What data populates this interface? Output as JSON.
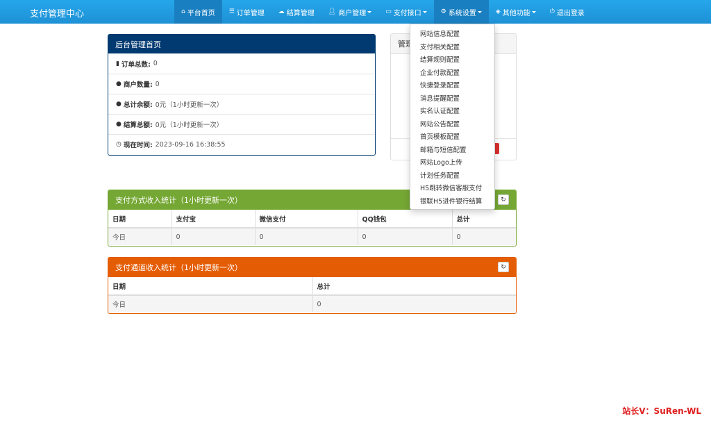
{
  "brand": "支付管理中心",
  "nav": [
    {
      "label": "平台首页",
      "icon": "home-icon"
    },
    {
      "label": "订单管理",
      "icon": "list-icon"
    },
    {
      "label": "结算管理",
      "icon": "cloud-icon"
    },
    {
      "label": "商户管理",
      "icon": "user-icon"
    },
    {
      "label": "支付接口",
      "icon": "card-icon"
    },
    {
      "label": "系统设置",
      "icon": "gear-icon"
    },
    {
      "label": "其他功能",
      "icon": "cube-icon"
    },
    {
      "label": "退出登录",
      "icon": "power-icon"
    }
  ],
  "dashboard": {
    "title": "后台管理首页",
    "rows": [
      {
        "label": "订单总数:",
        "value": "0",
        "icon": "bar-chart-icon"
      },
      {
        "label": "商户数量:",
        "value": "0",
        "icon": "drop-icon"
      },
      {
        "label": "总计余额:",
        "value": "0元（1小时更新一次）",
        "icon": "drop-icon"
      },
      {
        "label": "结算总额:",
        "value": "0元（1小时更新一次）",
        "icon": "drop-icon"
      },
      {
        "label": "现在时间:",
        "value": "2023-09-16 16:38:55",
        "icon": "clock-icon"
      }
    ]
  },
  "side_panel": {
    "title": "管理"
  },
  "method_stats": {
    "title": "支付方式收入统计（1小时更新一次）",
    "headers": [
      "日期",
      "支付宝",
      "微信支付",
      "QQ钱包",
      "总计"
    ],
    "row": [
      "今日",
      "0",
      "0",
      "0",
      "0"
    ]
  },
  "channel_stats": {
    "title": "支付通道收入统计（1小时更新一次）",
    "headers": [
      "日期",
      "总计"
    ],
    "row": [
      "今日",
      "0"
    ]
  },
  "settings_menu": [
    "网站信息配置",
    "支付相关配置",
    "结算规则配置",
    "企业付款配置",
    "快捷登录配置",
    "消息提醒配置",
    "实名认证配置",
    "网站公告配置",
    "首页模板配置",
    "邮箱与短信配置",
    "网站Logo上传",
    "计划任务配置",
    "H5跳转微信客服支付",
    "银联H5进件银行结算"
  ],
  "watermark": "站长V：SuRen-WL",
  "colors": {
    "nav": "#1e91d6",
    "dashboard_header": "#003a70",
    "method_header": "#75a734",
    "channel_header": "#e45d04"
  }
}
